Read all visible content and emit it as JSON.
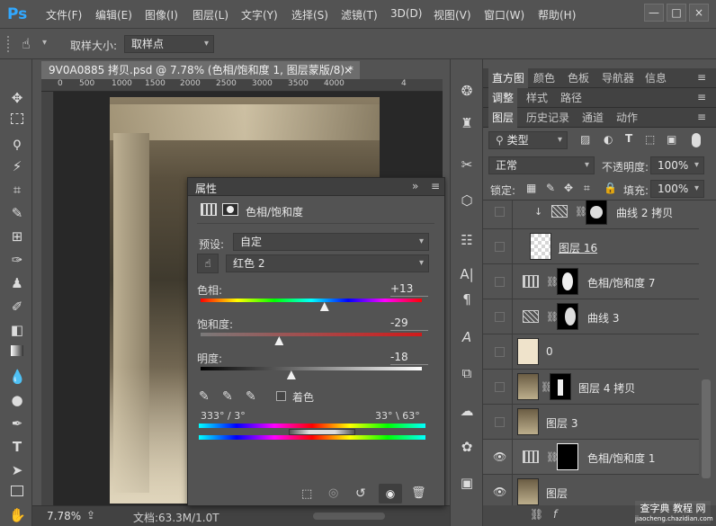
{
  "app": {
    "logo": "Ps"
  },
  "menu": [
    "文件(F)",
    "编辑(E)",
    "图像(I)",
    "图层(L)",
    "文字(Y)",
    "选择(S)",
    "滤镜(T)",
    "3D(D)",
    "视图(V)",
    "窗口(W)",
    "帮助(H)"
  ],
  "window_controls": {
    "minimize": "—",
    "restore": "□",
    "close": "×"
  },
  "options_bar": {
    "sample_size_label": "取样大小:",
    "sample_size_value": "取样点"
  },
  "document": {
    "tab_title": "9V0A0885 拷贝.psd @ 7.78% (色相/饱和度 1, 图层蒙版/8) *",
    "close": "×",
    "ruler_ticks": [
      "0",
      "500",
      "1000",
      "1500",
      "2000",
      "2500",
      "3000",
      "3500",
      "4000",
      "4"
    ],
    "zoom": "7.78%",
    "status": "文档:63.3M/1.0T"
  },
  "properties": {
    "title": "属性",
    "adjustment_name": "色相/饱和度",
    "preset_label": "预设:",
    "preset_value": "自定",
    "channel_value": "红色 2",
    "hue": {
      "label": "色相:",
      "value": "+13",
      "position": 0.56
    },
    "saturation": {
      "label": "饱和度:",
      "value": "-29",
      "position": 0.355
    },
    "lightness": {
      "label": "明度:",
      "value": "-18",
      "position": 0.41
    },
    "colorize_label": "着色",
    "range_left": "333° / 3°",
    "range_right": "33° \\ 63°"
  },
  "right_panel": {
    "tab_row1": [
      "直方图",
      "颜色",
      "色板",
      "导航器",
      "信息"
    ],
    "tab_row2": [
      "调整",
      "样式",
      "路径"
    ],
    "tab_row3": [
      "图层",
      "历史记录",
      "通道",
      "动作"
    ],
    "filter_kind": "类型",
    "blend_mode": "正常",
    "opacity_label": "不透明度:",
    "opacity_value": "100%",
    "lock_label": "锁定:",
    "fill_label": "填充:",
    "fill_value": "100%",
    "layers": [
      {
        "name": "曲线 2 拷贝",
        "visible": false,
        "type": "curves-clipped"
      },
      {
        "name": "图层 16",
        "visible": false,
        "type": "transparent"
      },
      {
        "name": "色相/饱和度 7",
        "visible": false,
        "type": "hue-sat"
      },
      {
        "name": "曲线 3",
        "visible": false,
        "type": "curves"
      },
      {
        "name": "0",
        "visible": false,
        "type": "beige"
      },
      {
        "name": "图层 4 拷贝",
        "visible": false,
        "type": "photo-mask"
      },
      {
        "name": "图层 3",
        "visible": false,
        "type": "photo"
      },
      {
        "name": "色相/饱和度 1",
        "visible": true,
        "type": "hue-sat-selected"
      },
      {
        "name": "图层",
        "visible": true,
        "type": "photo"
      }
    ]
  },
  "watermark": {
    "line1": "查字典 教程 网",
    "line2": "jiaocheng.chazidian.com"
  }
}
